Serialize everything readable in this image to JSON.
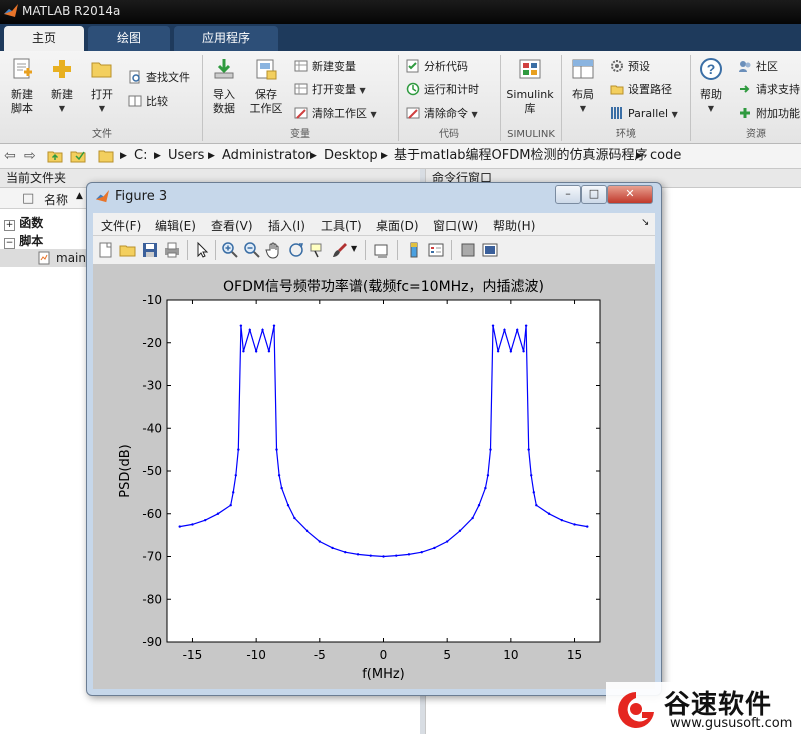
{
  "app": {
    "title": "MATLAB R2014a"
  },
  "tabs": [
    {
      "label": "主页"
    },
    {
      "label": "绘图"
    },
    {
      "label": "应用程序"
    }
  ],
  "ribbon": {
    "file": {
      "new_script": "新建\n脚本",
      "new": "新建",
      "open": "打开",
      "find_files": "查找文件",
      "compare": "比较",
      "group": "文件"
    },
    "variable": {
      "import": "导入\n数据",
      "save_ws": "保存\n工作区",
      "new_var": "新建变量",
      "open_var": "打开变量",
      "clear_ws": "清除工作区",
      "group": "变量"
    },
    "code": {
      "analyze": "分析代码",
      "run_time": "运行和计时",
      "clear_cmd": "清除命令",
      "group": "代码"
    },
    "simulink": {
      "library": "Simulink\n库",
      "group": "SIMULINK"
    },
    "env": {
      "layout": "布局",
      "prefs": "预设",
      "set_path": "设置路径",
      "parallel": "Parallel",
      "group": "环境"
    },
    "resources": {
      "help": "帮助",
      "community": "社区",
      "support": "请求支持",
      "addons": "附加功能",
      "group": "资源"
    }
  },
  "path": {
    "segments": [
      "C:",
      "Administrator",
      "Users",
      "Desktop",
      "基于matlab编程OFDM检测的仿真源码程序",
      "code"
    ]
  },
  "left_panel": {
    "title": "当前文件夹",
    "col_name": "名称",
    "folder_funcs": "函数",
    "folder_scripts": "脚本",
    "file_main": "main"
  },
  "cmd_panel": {
    "title": "命令行窗口"
  },
  "figure": {
    "title": "Figure 3",
    "menus": [
      "文件(F)",
      "编辑(E)",
      "查看(V)",
      "插入(I)",
      "工具(T)",
      "桌面(D)",
      "窗口(W)",
      "帮助(H)"
    ]
  },
  "watermark": {
    "brand": "谷速软件",
    "url": "www.gususoft.com"
  },
  "chart_data": {
    "type": "line",
    "title": "OFDM信号频带功率谱(载频fc=10MHz，内插滤波)",
    "xlabel": "f(MHz)",
    "ylabel": "PSD(dB)",
    "xlim": [
      -17,
      17
    ],
    "ylim": [
      -90,
      -10
    ],
    "xticks": [
      -15,
      -10,
      -5,
      0,
      5,
      10,
      15
    ],
    "yticks": [
      -10,
      -20,
      -30,
      -40,
      -50,
      -60,
      -70,
      -80,
      -90
    ],
    "color": "#0000ff",
    "series": [
      {
        "name": "",
        "x": [
          -16,
          -15,
          -14,
          -13,
          -12,
          -11.8,
          -11.6,
          -11.4,
          -11.2,
          -11.0,
          -10.5,
          -10.0,
          -9.5,
          -9.0,
          -8.6,
          -8.4,
          -8.2,
          -8.0,
          -7.5,
          -7.0,
          -6,
          -5,
          -4,
          -3,
          -2,
          -1,
          0,
          1,
          2,
          3,
          4,
          5,
          6,
          7,
          7.5,
          8.0,
          8.2,
          8.4,
          8.6,
          9.0,
          9.5,
          10.0,
          10.5,
          11.0,
          11.2,
          11.4,
          11.6,
          11.8,
          12,
          13,
          14,
          15,
          16
        ],
        "y": [
          -63,
          -62.5,
          -61.5,
          -60,
          -58,
          -55,
          -51,
          -45,
          -16,
          -22,
          -17,
          -22,
          -17,
          -22,
          -16,
          -45,
          -51,
          -54,
          -58,
          -61,
          -64,
          -66.5,
          -68,
          -69,
          -69.5,
          -69.8,
          -70,
          -69.8,
          -69.5,
          -69,
          -68,
          -66.5,
          -64,
          -61,
          -58,
          -54,
          -51,
          -45,
          -16,
          -22,
          -17,
          -22,
          -17,
          -22,
          -16,
          -45,
          -51,
          -55,
          -58,
          -60,
          -61.5,
          -62.5,
          -63
        ]
      }
    ]
  }
}
